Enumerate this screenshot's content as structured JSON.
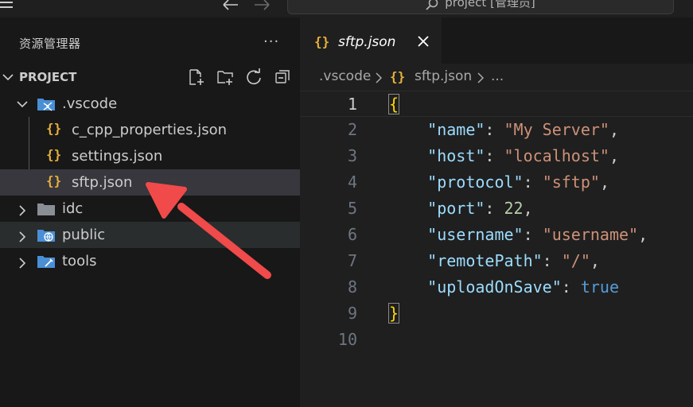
{
  "titlebar": {
    "search_text": "project [管理员]",
    "menu_icon": "hamburger-menu-icon",
    "back_icon": "arrow-left-icon",
    "forward_icon": "arrow-right-icon",
    "search_icon": "search-icon"
  },
  "sidebar": {
    "title": "资源管理器",
    "more": "···",
    "section": {
      "label": "PROJECT",
      "actions": [
        "new-file-icon",
        "new-folder-icon",
        "refresh-icon",
        "collapse-all-icon"
      ]
    },
    "tree": [
      {
        "label": ".vscode",
        "type": "folder",
        "expanded": true
      },
      {
        "label": "c_cpp_properties.json",
        "type": "json"
      },
      {
        "label": "settings.json",
        "type": "json"
      },
      {
        "label": "sftp.json",
        "type": "json",
        "selected": true
      },
      {
        "label": "idc",
        "type": "folder",
        "expanded": false
      },
      {
        "label": "public",
        "type": "folder",
        "expanded": false
      },
      {
        "label": "tools",
        "type": "folder",
        "expanded": false
      }
    ],
    "json_glyph": "{}"
  },
  "editor": {
    "tab": {
      "label": "sftp.json",
      "icon": "{}",
      "close": "close-icon"
    },
    "breadcrumb": [
      ".vscode",
      "{}",
      "sftp.json",
      "..."
    ],
    "line_numbers": [
      "1",
      "2",
      "3",
      "4",
      "5",
      "6",
      "7",
      "8",
      "9",
      "10"
    ],
    "code": {
      "open": "{",
      "close": "}",
      "entries": [
        {
          "key": "\"name\"",
          "value": "\"My Server\"",
          "vtype": "str",
          "comma": ","
        },
        {
          "key": "\"host\"",
          "value": "\"localhost\"",
          "vtype": "str",
          "comma": ","
        },
        {
          "key": "\"protocol\"",
          "value": "\"sftp\"",
          "vtype": "str",
          "comma": ","
        },
        {
          "key": "\"port\"",
          "value": "22",
          "vtype": "num",
          "comma": ","
        },
        {
          "key": "\"username\"",
          "value": "\"username\"",
          "vtype": "str",
          "comma": ","
        },
        {
          "key": "\"remotePath\"",
          "value": "\"/\"",
          "vtype": "str",
          "comma": ","
        },
        {
          "key": "\"uploadOnSave\"",
          "value": "true",
          "vtype": "kw",
          "comma": ""
        }
      ]
    }
  },
  "annotation": {
    "color": "#f04a4a",
    "icon": "red-arrow-pointer"
  }
}
